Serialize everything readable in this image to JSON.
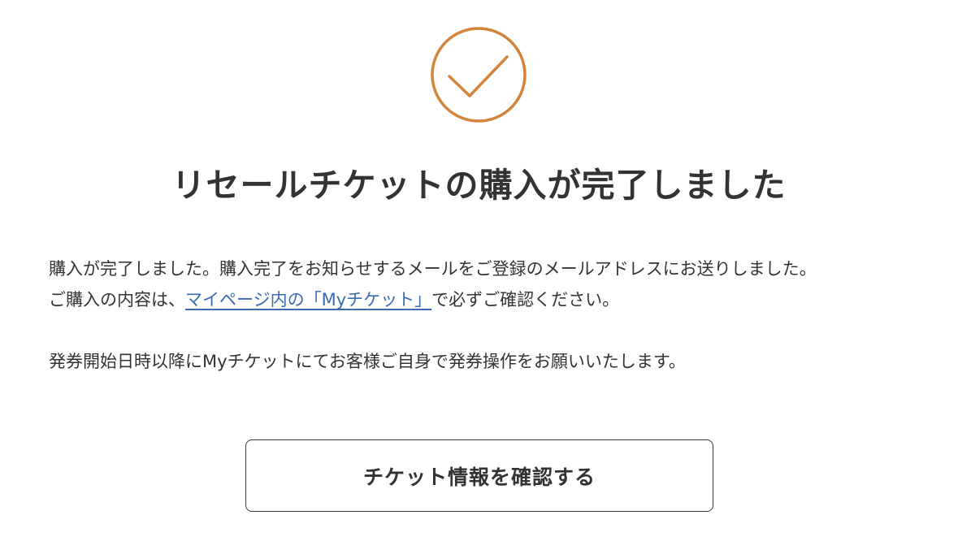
{
  "colors": {
    "accent": "#d4843a",
    "text": "#333333",
    "link": "#3b6bb3",
    "button_border": "#3a3a3a"
  },
  "icon": "check-circle-icon",
  "title": "リセールチケットの購入が完了しました",
  "message": {
    "line1": "購入が完了しました。購入完了をお知らせするメールをご登録のメールアドレスにお送りしました。",
    "line2_prefix": "ご購入の内容は、",
    "line2_link": "マイページ内の「Myチケット」",
    "line2_suffix": "で必ずご確認ください。",
    "line3": "発券開始日時以降にMyチケットにてお客様ご自身で発券操作をお願いいたします。"
  },
  "button": {
    "label": "チケット情報を確認する"
  }
}
